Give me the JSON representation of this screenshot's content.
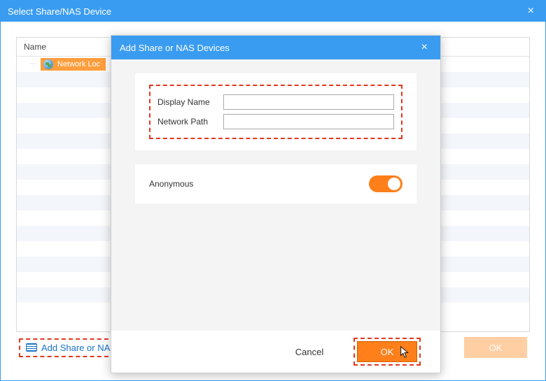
{
  "window": {
    "title": "Select Share/NAS Device"
  },
  "list": {
    "header": "Name",
    "selected_item": "Network Loc"
  },
  "footer": {
    "add_label": "Add Share or NAS Devices",
    "cancel": "Cancel",
    "ok": "OK"
  },
  "modal": {
    "title": "Add Share or NAS Devices",
    "display_name_label": "Display Name",
    "display_name_value": "",
    "network_path_label": "Network Path",
    "network_path_value": "",
    "anonymous_label": "Anonymous",
    "anonymous_on": true,
    "cancel": "Cancel",
    "ok": "OK"
  }
}
